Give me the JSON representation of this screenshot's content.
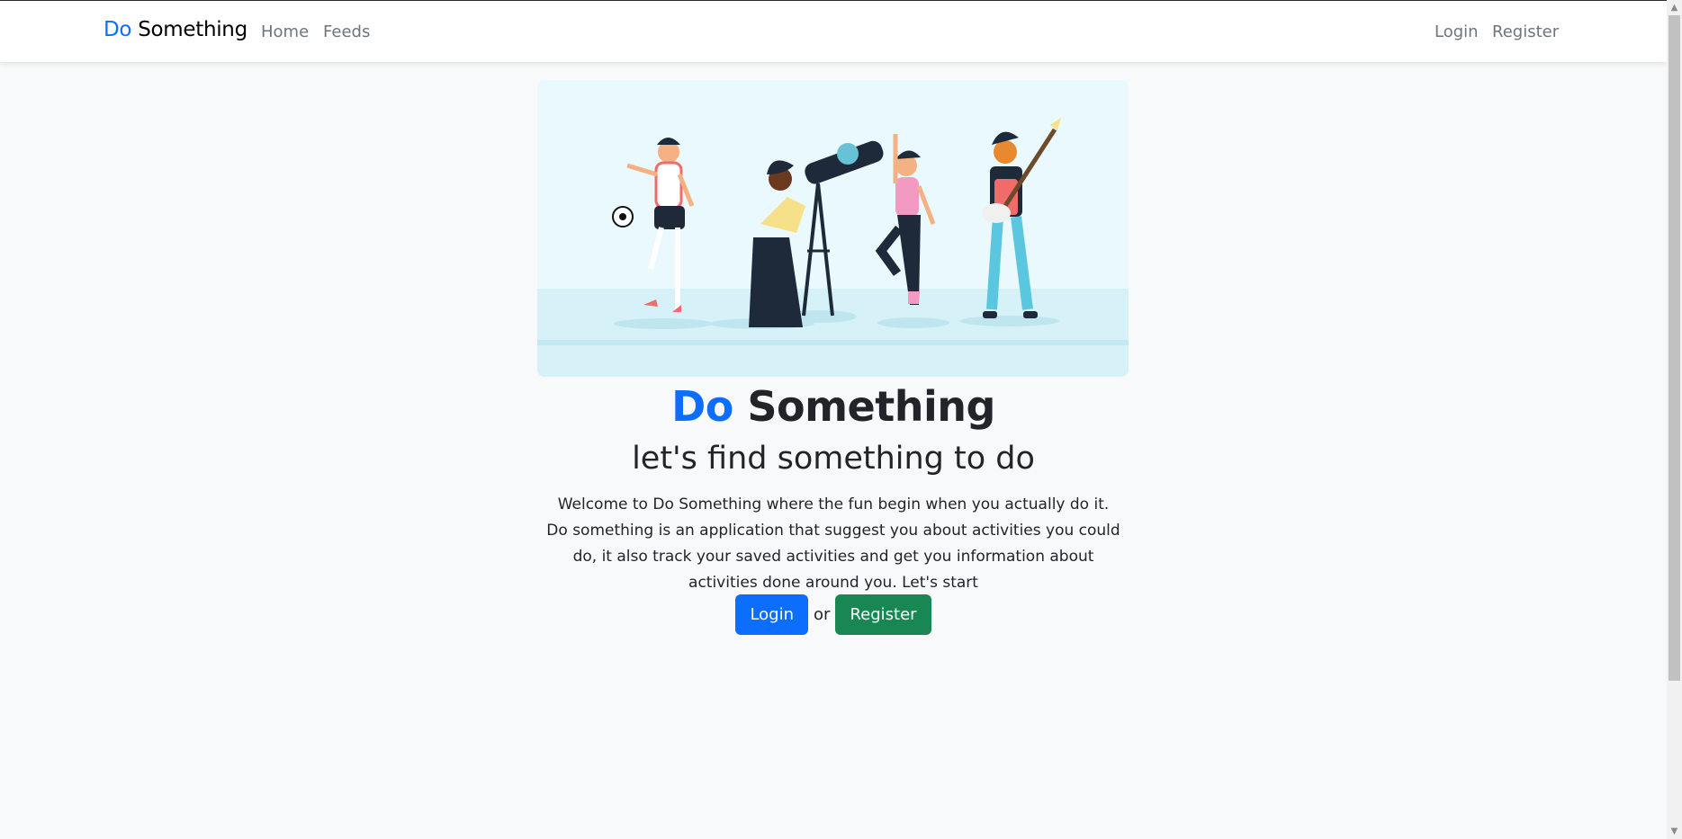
{
  "nav": {
    "brand_do": "Do",
    "brand_rest": " Something",
    "links": [
      "Home",
      "Feeds"
    ],
    "right_links": [
      "Login",
      "Register"
    ]
  },
  "hero": {
    "title_do": "Do",
    "title_rest": " Something",
    "subtitle": "let's find something to do",
    "line1": "Welcome to Do Something where the fun begin when you actually do it.",
    "line2": "Do something is an application that suggest you about activities you could do, it also track your saved activities and get you information about activities done around you. Let's start",
    "login_label": "Login",
    "or_label": "or",
    "register_label": "Register",
    "illustration_icon": "people-hobbies-illustration"
  },
  "colors": {
    "primary": "#0d6efd",
    "success": "#198754",
    "background": "#f8f9fa"
  }
}
